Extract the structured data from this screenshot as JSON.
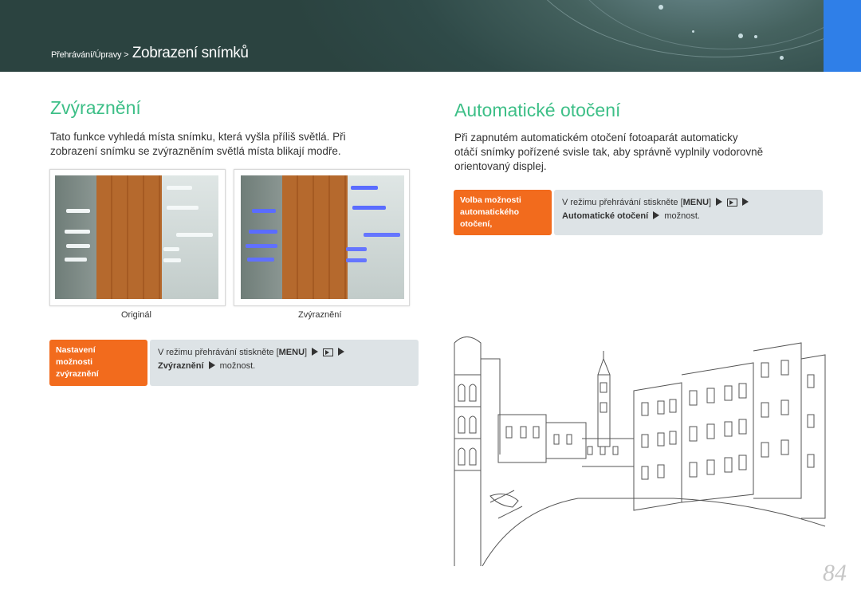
{
  "header": {
    "breadcrumb_small": "Přehrávání/Úpravy >",
    "breadcrumb_big": "Zobrazení snímků"
  },
  "left": {
    "heading": "Zvýraznění",
    "paragraph_line1": "Tato funkce vyhledá místa snímku, která vyšla příliš světlá. Při",
    "paragraph_line2": "zobrazení snímku se zvýrazněním světlá místa blikají modře.",
    "caption_original": "Originál",
    "caption_highlight": "Zvýraznění",
    "instruction": {
      "label_line1": "Nastavení",
      "label_line2": "možnosti",
      "label_line3": "zvýraznění",
      "text_prefix": "V režimu přehrávání stiskněte [",
      "menu_key": "MENU",
      "text_bracket": "]",
      "option": "Zvýraznění",
      "suffix": "možnost."
    }
  },
  "right": {
    "heading": "Automatické otočení",
    "paragraph_line1": "Při zapnutém automatickém otočení fotoaparát automaticky",
    "paragraph_line2": "otáčí snímky pořízené svisle tak, aby správně vyplnily vodorovně",
    "paragraph_line3": "orientovaný displej.",
    "instruction": {
      "label_line1": "Volba možnosti",
      "label_line2": "automatického",
      "label_line3": "otočení,",
      "text_prefix": "V režimu přehrávání stiskněte [",
      "menu_key": "MENU",
      "text_bracket": "]",
      "option": "Automatické otočení",
      "suffix": "možnost."
    }
  },
  "page_number": "84",
  "colors": {
    "heading_green": "#3dbf87",
    "label_orange": "#f26b1d",
    "instruction_bg": "#dde3e6",
    "header_tab_blue": "#2f7fe8",
    "highlight_blink_blue": "#5a6cff"
  },
  "icons": [
    "playback-icon",
    "arrow-right-icon"
  ]
}
